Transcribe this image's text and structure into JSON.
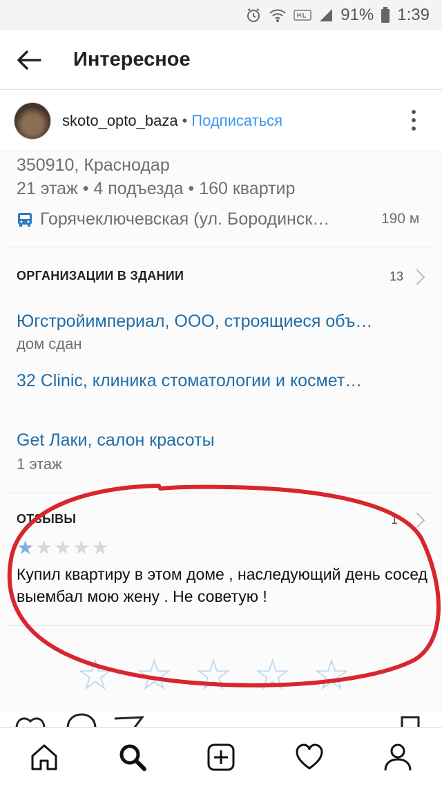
{
  "status": {
    "battery": "91%",
    "time": "1:39"
  },
  "appbar": {
    "title": "Интересное"
  },
  "post": {
    "username": "skoto_opto_baza",
    "separator": "•",
    "follow_label": "Подписаться"
  },
  "place": {
    "address": "350910, Краснодар",
    "building_info": "21 этаж • 4 подъезда • 160 квартир",
    "stop": "Горячеключевская (ул. Бородинск…",
    "stop_distance": "190 м"
  },
  "organizations": {
    "header": "ОРГАНИЗАЦИИ В ЗДАНИИ",
    "count": "13",
    "items": [
      {
        "name": "Югстройимпериал, ООО, строящиеся объ…",
        "detail": "дом сдан"
      },
      {
        "name": "32 Clinic, клиника стоматологии и космет…",
        "detail": ""
      },
      {
        "name": "Get Лаки, салон красоты",
        "detail": "1 этаж"
      }
    ]
  },
  "reviews": {
    "header": "ОТЗЫВЫ",
    "count": "1",
    "rating": 1,
    "max_rating": 5,
    "text": "Купил квартиру в этом доме , наследующий день сосед выембал мою жену . Не советую !"
  },
  "colors": {
    "link": "#1f6ea8",
    "follow": "#3897f0",
    "annotation": "#d8262f"
  },
  "tabbar": [
    "home-icon",
    "search-icon",
    "add-post-icon",
    "heart-icon",
    "profile-icon"
  ]
}
